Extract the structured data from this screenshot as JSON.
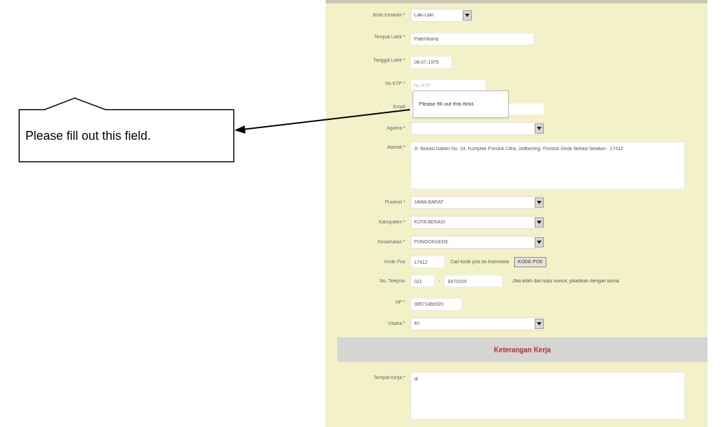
{
  "annotation": {
    "text": "Please fill out this field."
  },
  "form": {
    "fields": [
      {
        "kind": "select",
        "label": "Jenis Kelamin *",
        "value": "Laki-Laki"
      },
      {
        "kind": "text",
        "label": "Tempat Lahir *",
        "value": "Palembang"
      },
      {
        "kind": "text",
        "label": "Tanggal Lahir *",
        "value": "08-07-1975"
      },
      {
        "kind": "text",
        "label": "No KTP *",
        "placeholder": "No KTP",
        "validation_message": "Please fill out this field."
      },
      {
        "kind": "text",
        "label": "Email"
      },
      {
        "kind": "select",
        "label": "Agama *"
      },
      {
        "kind": "textarea",
        "label": "Alamat *",
        "value": "Jl. Bekasi Dalam No. 14, Komplek Pondok Citra, Jatibening, Pondok Gede Bekasi Selatan - 17412"
      },
      {
        "kind": "select",
        "label": "Provinsi *",
        "value": "JAWA BARAT"
      },
      {
        "kind": "select",
        "label": "Kabupaten *",
        "value": "KOTA BEKASI"
      },
      {
        "kind": "select",
        "label": "Kecamatan *",
        "value": "PONDOKGEDE"
      },
      {
        "kind": "postcode",
        "label": "Kode Pos",
        "value": "17412",
        "hint": "Cari kode pos se-Indonesia",
        "button": "KODE POS"
      },
      {
        "kind": "phone",
        "label": "No. Telepon",
        "area": "021",
        "separator": "-",
        "value": "8479109",
        "hint": "Jika lebih dari satu nomor, pisahkan dengan koma"
      },
      {
        "kind": "text",
        "label": "HP *",
        "value": "08571466920"
      },
      {
        "kind": "select",
        "label": "Usaha *",
        "value": "40"
      }
    ],
    "section": {
      "title": "Keterangan Kerja"
    },
    "work_fields": [
      {
        "kind": "textarea",
        "label": "Tempat Kerja *",
        "value": "dl"
      }
    ]
  }
}
